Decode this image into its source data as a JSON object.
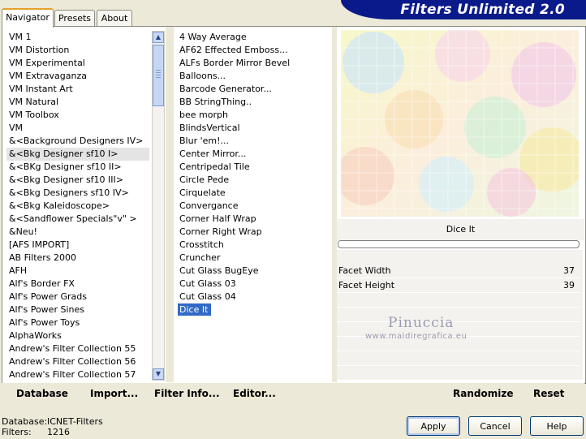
{
  "header": {
    "title": "Filters Unlimited 2.0"
  },
  "tabs": [
    {
      "label": "Navigator",
      "active": true
    },
    {
      "label": "Presets",
      "active": false
    },
    {
      "label": "About",
      "active": false
    }
  ],
  "categories": [
    "VM 1",
    "VM Distortion",
    "VM Experimental",
    "VM Extravaganza",
    "VM Instant Art",
    "VM Natural",
    "VM Toolbox",
    "VM",
    "&<Background Designers IV>",
    "&<Bkg Designer sf10 I>",
    "&<BKg Designer sf10 II>",
    "&<Bkg Designer sf10 III>",
    "&<Bkg Designers sf10 IV>",
    "&<Bkg Kaleidoscope>",
    "&<Sandflower Specials\"v\" >",
    "&Neu!",
    "[AFS IMPORT]",
    "AB Filters 2000",
    "AFH",
    "Alf's Border FX",
    "Alf's Power Grads",
    "Alf's Power Sines",
    "Alf's Power Toys",
    "AlphaWorks",
    "Andrew's Filter Collection 55",
    "Andrew's Filter Collection 56",
    "Andrew's Filter Collection 57"
  ],
  "selected_category": "&<Bkg Designer sf10 I>",
  "filters": [
    "4 Way Average",
    "AF62 Effected Emboss...",
    "ALFs Border Mirror Bevel",
    "Balloons...",
    "Barcode Generator...",
    "BB StringThing..",
    "bee morph",
    "BlindsVertical",
    "Blur 'em!...",
    "Center Mirror...",
    "Centripedal Tile",
    "Circle Pede",
    "Cirquelate",
    "Convergance",
    "Corner Half Wrap",
    "Corner Right Wrap",
    "Crosstitch",
    "Cruncher",
    "Cut Glass  BugEye",
    "Cut Glass 03",
    "Cut Glass 04",
    "Dice It"
  ],
  "selected_filter": "Dice It",
  "preview": {
    "label": "Dice It"
  },
  "parameters": [
    {
      "name": "Facet Width",
      "value": "37"
    },
    {
      "name": "Facet Height",
      "value": "39"
    }
  ],
  "watermark": {
    "line1": "Pinuccia",
    "line2": "www.maidiregrafica.eu"
  },
  "toolbar": {
    "database": "Database",
    "import": "Import...",
    "filter_info": "Filter Info...",
    "editor": "Editor...",
    "randomize": "Randomize",
    "reset": "Reset"
  },
  "status": {
    "database_label": "Database:",
    "database_value": "ICNET-Filters",
    "filters_label": "Filters:",
    "filters_value": "1216"
  },
  "buttons": {
    "apply": "Apply",
    "cancel": "Cancel",
    "help": "Help"
  },
  "icons": {
    "scroll_up": "chevron-up-icon",
    "scroll_down": "chevron-down-icon"
  }
}
